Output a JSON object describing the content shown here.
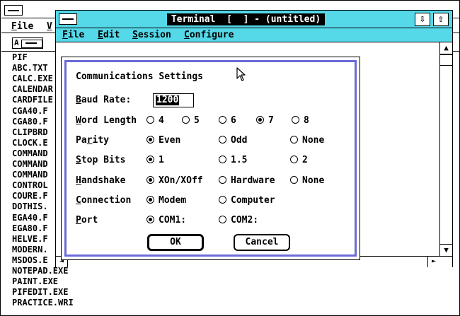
{
  "background_window": {
    "menu": [
      "File",
      "V"
    ],
    "drive_label": "A",
    "files": [
      "PIF",
      "ABC.TXT",
      "CALC.EXE",
      "CALENDAR",
      "CARDFILE",
      "CGA40.F",
      "CGA80.F",
      "CLIPBRD",
      "CLOCK.E",
      "COMMAND",
      "COMMAND",
      "COMMAND",
      "CONTROL",
      "COURE.F",
      "DOTHIS.",
      "EGA40.F",
      "EGA80.F",
      "HELVE.F",
      "MODERN.",
      "MSDOS.E",
      "NOTEPAD.EXE",
      "PAINT.EXE",
      "PIFEDIT.EXE",
      "PRACTICE.WRI"
    ]
  },
  "terminal": {
    "title": "Terminal  [  ] - (untitled)",
    "min_icon": "⇩",
    "max_icon": "⇧",
    "menu": [
      "File",
      "Edit",
      "Session",
      "Configure"
    ]
  },
  "dialog": {
    "title": "Communications Settings",
    "baud_label": "Baud Rate:",
    "baud_value": "1200",
    "rows": [
      {
        "label": "Word Length",
        "options": [
          "4",
          "5",
          "6",
          "7",
          "8"
        ],
        "selected": "7"
      },
      {
        "label": "Parity",
        "options": [
          "Even",
          "Odd",
          "None"
        ],
        "selected": "Even"
      },
      {
        "label": "Stop Bits",
        "options": [
          "1",
          "1.5",
          "2"
        ],
        "selected": "1"
      },
      {
        "label": "Handshake",
        "options": [
          "XOn/XOff",
          "Hardware",
          "None"
        ],
        "selected": "XOn/XOff"
      },
      {
        "label": "Connection",
        "options": [
          "Modem",
          "Computer"
        ],
        "selected": "Modem"
      },
      {
        "label": "Port",
        "options": [
          "COM1:",
          "COM2:"
        ],
        "selected": "COM1:"
      }
    ],
    "ok_label": "OK",
    "cancel_label": "Cancel"
  },
  "scroll_icons": {
    "up": "▲",
    "down": "▼",
    "left": "◄",
    "right": "►"
  }
}
